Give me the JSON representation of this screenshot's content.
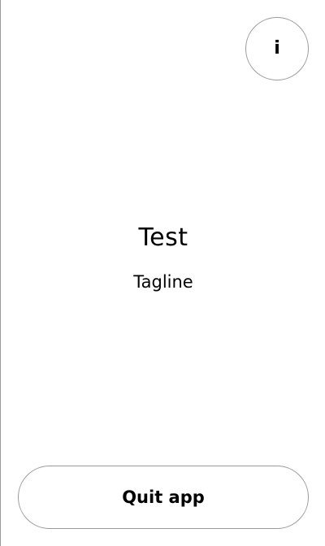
{
  "header": {
    "info_button": {
      "icon": "info-icon",
      "glyph": "i"
    }
  },
  "main": {
    "title": "Test",
    "tagline": "Tagline"
  },
  "footer": {
    "quit_label": "Quit app"
  },
  "colors": {
    "background": "#ffffff",
    "border": "#9a9a9a",
    "text": "#000000"
  }
}
